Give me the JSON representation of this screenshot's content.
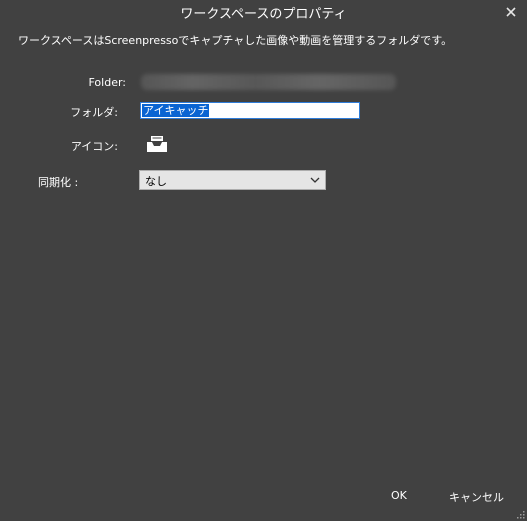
{
  "window": {
    "title": "ワークスペースのプロパティ",
    "close_icon": "close-icon"
  },
  "description": "ワークスペースはScreenpressoでキャプチャした画像や動画を管理するフォルダです。",
  "fields": {
    "folder_label": "Folder:",
    "folder_name_label": "フォルダ:",
    "folder_name_value": "アイキャッチ",
    "icon_label": "アイコン:",
    "icon_name": "inbox-tray-icon",
    "sync_label": "同期化 :",
    "sync_value": "なし"
  },
  "buttons": {
    "ok": "OK",
    "cancel": "キャンセル"
  },
  "colors": {
    "background": "#414141",
    "selection": "#0a64d2",
    "input_border": "#2f7cd8"
  }
}
